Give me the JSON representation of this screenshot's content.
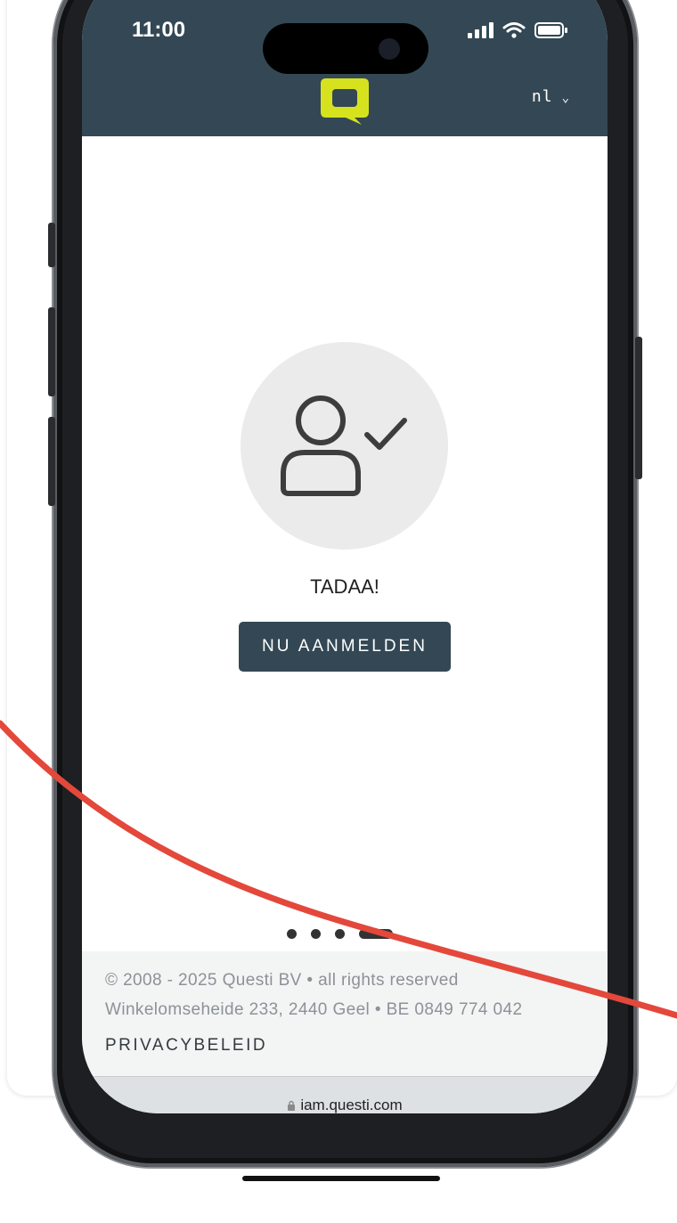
{
  "status_bar": {
    "time": "11:00"
  },
  "header": {
    "language": "nl",
    "lang_chevron": "⌄"
  },
  "main": {
    "success_title": "TADAA!",
    "login_button": "NU AANMELDEN"
  },
  "pagination": {
    "total": 4,
    "active_index": 3
  },
  "footer": {
    "copyright": "© 2008 - 2025 Questi BV • all rights reserved",
    "address": "Winkelomseheide 233, 2440 Geel • BE 0849 774 042",
    "privacy_link": "PRIVACYBELEID"
  },
  "browser": {
    "url": "iam.questi.com"
  },
  "colors": {
    "header_bg": "#334854",
    "logo_yellow": "#d7e21f",
    "annotation_red": "#e3483b"
  }
}
